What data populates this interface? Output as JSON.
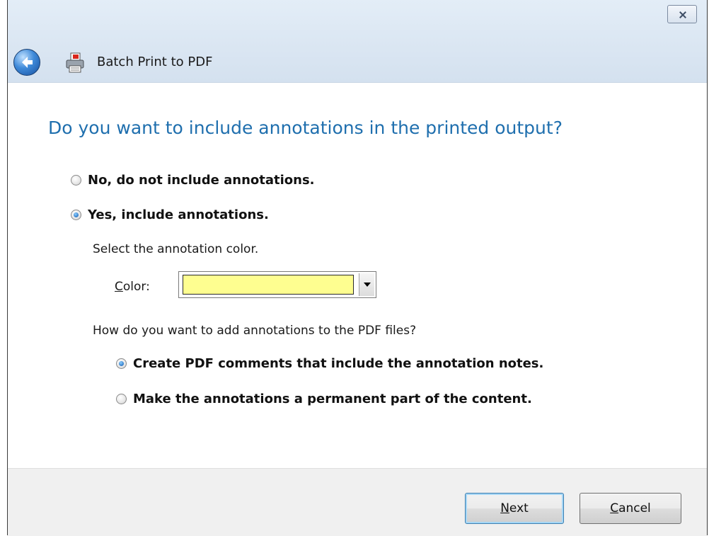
{
  "window": {
    "title": "Batch Print to PDF",
    "close_icon": "close-icon",
    "back_icon": "back-arrow-icon",
    "app_icon": "printer-pdf-icon"
  },
  "page": {
    "heading": "Do you want to include annotations in the printed output?"
  },
  "include_annotations": {
    "options": [
      {
        "label": "No, do not include annotations.",
        "selected": false
      },
      {
        "label": "Yes, include annotations.",
        "selected": true
      }
    ]
  },
  "color": {
    "prompt": "Select the annotation color.",
    "label_accel": "C",
    "label_rest": "olor:",
    "value_hex": "#fefe90"
  },
  "add_method": {
    "prompt": "How do you want to add annotations to the PDF files?",
    "options": [
      {
        "label": "Create PDF comments that include the annotation notes.",
        "selected": true
      },
      {
        "label": "Make the annotations a permanent part of the content.",
        "selected": false
      }
    ]
  },
  "footer": {
    "next_accel": "N",
    "next_rest": "ext",
    "cancel_accel": "C",
    "cancel_rest": "ancel"
  }
}
